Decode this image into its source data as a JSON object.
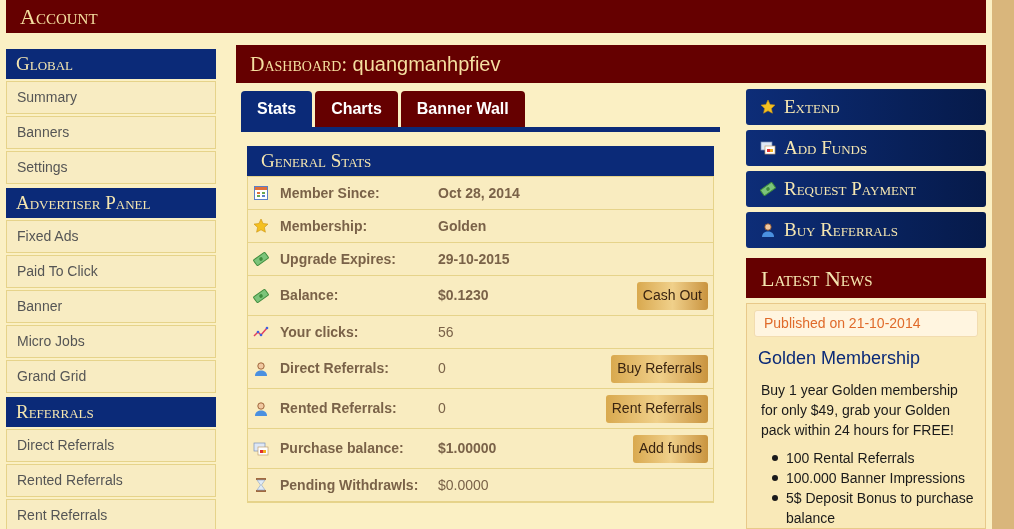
{
  "header": {
    "title": "Account"
  },
  "sidebar": [
    {
      "heading": "Global",
      "items": [
        "Summary",
        "Banners",
        "Settings"
      ]
    },
    {
      "heading": "Advertiser Panel",
      "items": [
        "Fixed Ads",
        "Paid To Click",
        "Banner",
        "Micro Jobs",
        "Grand Grid"
      ]
    },
    {
      "heading": "Referrals",
      "items": [
        "Direct Referrals",
        "Rented Referrals",
        "Rent Referrals"
      ]
    }
  ],
  "dashboard": {
    "title_prefix": "Dashboard:",
    "username": "quangmanhpfiev"
  },
  "tabs": [
    {
      "label": "Stats",
      "selected": true
    },
    {
      "label": "Charts",
      "selected": false
    },
    {
      "label": "Banner Wall",
      "selected": false
    }
  ],
  "general_stats": {
    "title": "General Stats",
    "rows": [
      {
        "label": "Member Since:",
        "value": "Oct 28, 2014",
        "bold": true
      },
      {
        "label": "Membership:",
        "value": "Golden",
        "bold": true
      },
      {
        "label": "Upgrade Expires:",
        "value": "29-10-2015",
        "bold": true
      },
      {
        "label": "Balance:",
        "value": "$0.1230",
        "bold": true,
        "button": "Cash Out"
      },
      {
        "label": "Your clicks:",
        "value": "56",
        "bold": false
      },
      {
        "label": "Direct Referrals:",
        "value": "0",
        "bold": false,
        "button": "Buy Referrals"
      },
      {
        "label": "Rented Referrals:",
        "value": "0",
        "bold": false,
        "button": "Rent Referrals"
      },
      {
        "label": "Purchase balance:",
        "value": "$1.00000",
        "bold": true,
        "button": "Add funds"
      },
      {
        "label": "Pending Withdrawls:",
        "value": "$0.0000",
        "bold": false
      }
    ]
  },
  "actions": [
    "Extend",
    "Add Funds",
    "Request Payment",
    "Buy Referrals"
  ],
  "latest_news": {
    "title": "Latest News",
    "published": "Published on 21-10-2014",
    "headline": "Golden Membership",
    "body": "Buy 1 year Golden membership for only $49, grab your Golden pack within 24 hours for FREE!",
    "bullets": [
      "100 Rental Referrals",
      "100.000 Banner Impressions",
      "5$ Deposit Bonus to purchase balance"
    ]
  }
}
